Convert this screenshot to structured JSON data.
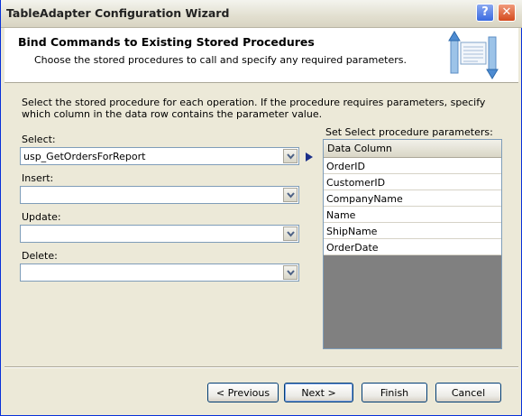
{
  "window": {
    "title": "TableAdapter Configuration Wizard",
    "help_glyph": "?",
    "close_glyph": "✕"
  },
  "header": {
    "title": "Bind Commands to Existing Stored Procedures",
    "subtitle": "Choose the stored procedures to call and specify any required parameters."
  },
  "main": {
    "instructions": "Select the stored procedure for each operation. If the procedure requires parameters, specify which column in the data row contains the parameter value.",
    "select_label": "Select:",
    "select_value": "usp_GetOrdersForReport",
    "insert_label": "Insert:",
    "insert_value": "",
    "update_label": "Update:",
    "update_value": "",
    "delete_label": "Delete:",
    "delete_value": ""
  },
  "params": {
    "label": "Set Select procedure parameters:",
    "column_header": "Data Column",
    "rows": [
      "OrderID",
      "CustomerID",
      "CompanyName",
      "Name",
      "ShipName",
      "OrderDate"
    ]
  },
  "footer": {
    "previous_label": "< Previous",
    "next_label": "Next >",
    "finish_label": "Finish",
    "cancel_label": "Cancel"
  },
  "colors": {
    "window_border": "#0831d9",
    "dialog_bg": "#ece9d8",
    "grid_empty": "#808080",
    "arrow": "#1b2f8a"
  }
}
